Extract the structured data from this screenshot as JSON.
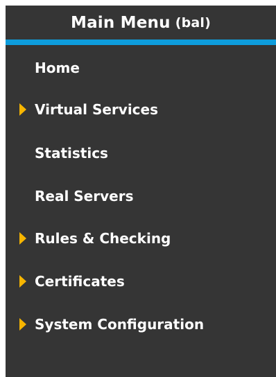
{
  "menu": {
    "title": "Main Menu",
    "user_badge": "(bal)",
    "accent_color": "#0e9ddc",
    "arrow_color": "#f7b500",
    "background_color": "#353535",
    "items": [
      {
        "label": "Home",
        "has_submenu": false
      },
      {
        "label": "Virtual Services",
        "has_submenu": true
      },
      {
        "label": "Statistics",
        "has_submenu": false
      },
      {
        "label": "Real Servers",
        "has_submenu": false
      },
      {
        "label": "Rules & Checking",
        "has_submenu": true
      },
      {
        "label": "Certificates",
        "has_submenu": true
      },
      {
        "label": "System Configuration",
        "has_submenu": true
      }
    ]
  }
}
